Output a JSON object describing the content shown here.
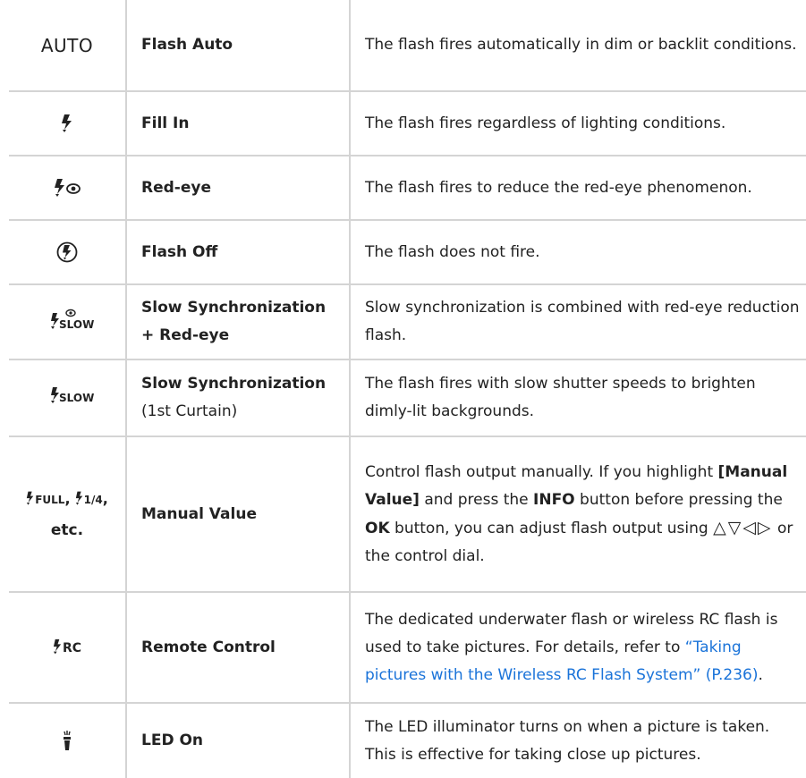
{
  "rows": [
    {
      "icon": "flash-auto-icon",
      "icon_text": "AUTO",
      "name": "Flash Auto",
      "name_sub": "",
      "desc": "The flash fires automatically in dim or backlit conditions."
    },
    {
      "icon": "flash-fill-in-icon",
      "name": "Fill In",
      "name_sub": "",
      "desc": "The flash fires regardless of lighting conditions."
    },
    {
      "icon": "flash-red-eye-icon",
      "name": "Red-eye",
      "name_sub": "",
      "desc": "The flash fires to reduce the red-eye phenomenon."
    },
    {
      "icon": "flash-off-icon",
      "name": "Flash Off",
      "name_sub": "",
      "desc": "The flash does not fire."
    },
    {
      "icon": "flash-slow-red-eye-icon",
      "icon_text": "SLOW",
      "name": "Slow Synchronization",
      "name_line2": "+ Red-eye",
      "desc": "Slow synchronization is combined with red-eye reduction flash."
    },
    {
      "icon": "flash-slow-icon",
      "icon_text": "SLOW",
      "name": "Slow Synchronization",
      "name_sub": "(1st Curtain)",
      "desc": "The flash fires with slow shutter speeds to brighten dimly-lit backgrounds."
    },
    {
      "icon": "flash-manual-icon",
      "icon_text_1": "FULL",
      "icon_text_2": "1/4",
      "icon_sep": ",",
      "icon_etc": "etc.",
      "name": "Manual Value",
      "desc_parts": {
        "p1": "Control flash output manually. If you highlight ",
        "b1": "[Manual Value]",
        "p2": " and press the ",
        "b2": "INFO",
        "p3": " button before pressing the ",
        "b3": "OK",
        "p4": " button, you can adjust flash output using ",
        "arrows": "△▽◁▷",
        "p5": " or the control dial."
      }
    },
    {
      "icon": "flash-remote-icon",
      "icon_text": "RC",
      "name": "Remote Control",
      "desc_parts": {
        "p1": "The dedicated underwater flash or wireless RC flash is used to take pictures. For details, refer to ",
        "link": "“Taking pictures with the Wireless RC Flash System” (P.236)",
        "p2": "."
      }
    },
    {
      "icon": "led-illuminator-icon",
      "name": "LED On",
      "desc": "The LED illuminator turns on when a picture is taken. This is effective for taking close up pictures."
    }
  ],
  "colors": {
    "text": "#222222",
    "border": "#d4d4d4",
    "link": "#1a73d9"
  }
}
